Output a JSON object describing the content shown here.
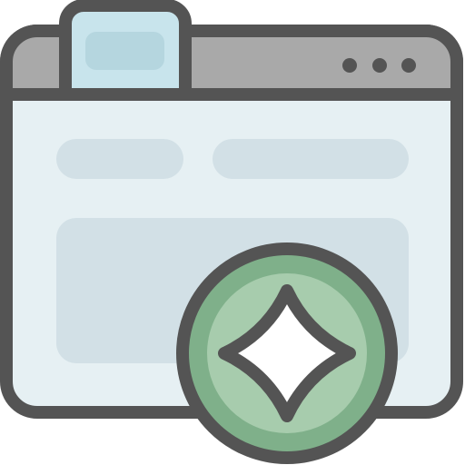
{
  "icon": {
    "name": "browser-window-sparkle-icon",
    "window_controls": [
      "dot",
      "dot",
      "dot"
    ],
    "badge_icon": "sparkle-icon"
  },
  "colors": {
    "outline": "#545454",
    "window_body": "#e6f0f3",
    "title_bar": "#a9a9a9",
    "tab": "#c8e4ec",
    "tab_inner": "#b5d6df",
    "placeholder": "#d2e0e6",
    "badge_outer": "#7fb08a",
    "badge_inner": "#a7ccad",
    "sparkle": "#ffffff",
    "background": "#ffffff"
  }
}
